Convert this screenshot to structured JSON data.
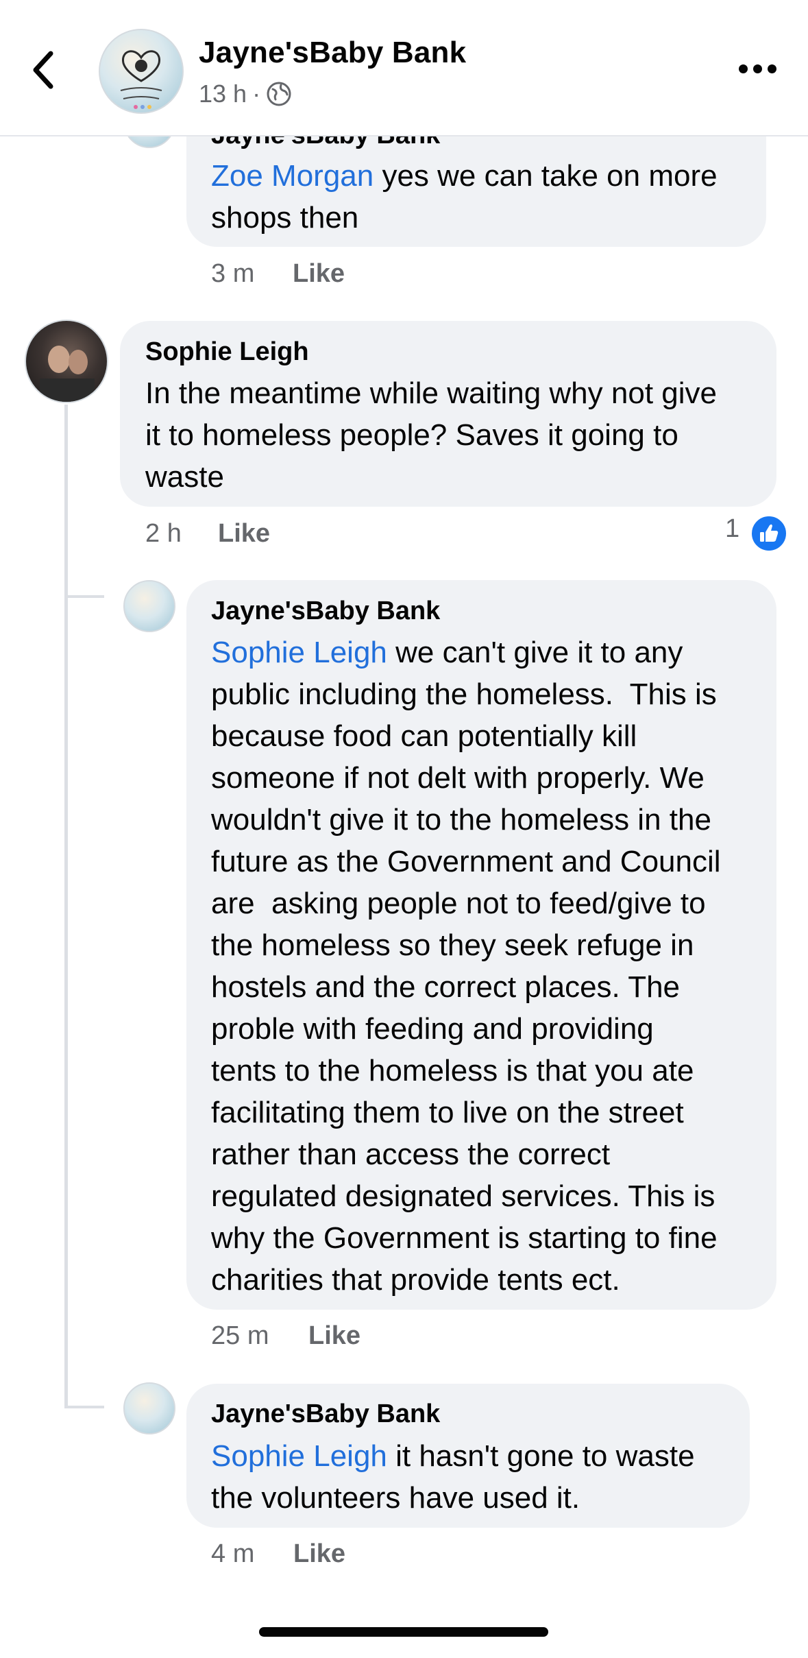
{
  "header": {
    "title": "Jayne'sBaby Bank",
    "time": "13 h",
    "separator": "·"
  },
  "comments": [
    {
      "author": "Jayne'sBaby Bank",
      "mention": "Zoe Morgan",
      "text": " yes we can take on more\nshops then",
      "time": "3 m",
      "like": "Like"
    },
    {
      "author": "Sophie Leigh",
      "text": "In the meantime while waiting why not give\nit to homeless people? Saves it going to\nwaste",
      "time": "2 h",
      "like": "Like",
      "reaction_count": "1"
    },
    {
      "author": "Jayne'sBaby Bank",
      "mention": "Sophie Leigh",
      "text": " we can't give it to any\npublic including the homeless.  This is\nbecause food can potentially kill\nsomeone if not delt with properly. We\nwouldn't give it to the homeless in the\nfuture as the Government and Council\nare  asking people not to feed/give to\nthe homeless so they seek refuge in\nhostels and the correct places. The\nproble with feeding and providing\ntents to the homeless is that you ate\nfacilitating them to live on the street\nrather than access the correct\nregulated designated services. This is\nwhy the Government is starting to fine\ncharities that provide tents ect.",
      "time": "25 m",
      "like": "Like"
    },
    {
      "author": "Jayne'sBaby Bank",
      "mention": "Sophie Leigh",
      "text": " it hasn't gone to waste\nthe volunteers have used it.",
      "time": "4 m",
      "like": "Like"
    }
  ],
  "colors": {
    "mention": "#216fdb",
    "like_blue": "#1877f2",
    "bubble": "#f0f2f5",
    "muted": "#65676b"
  },
  "icons": {
    "back": "chevron-left-icon",
    "more": "more-horizontal-icon",
    "privacy": "globe-icon",
    "reaction": "thumbs-up-icon"
  }
}
